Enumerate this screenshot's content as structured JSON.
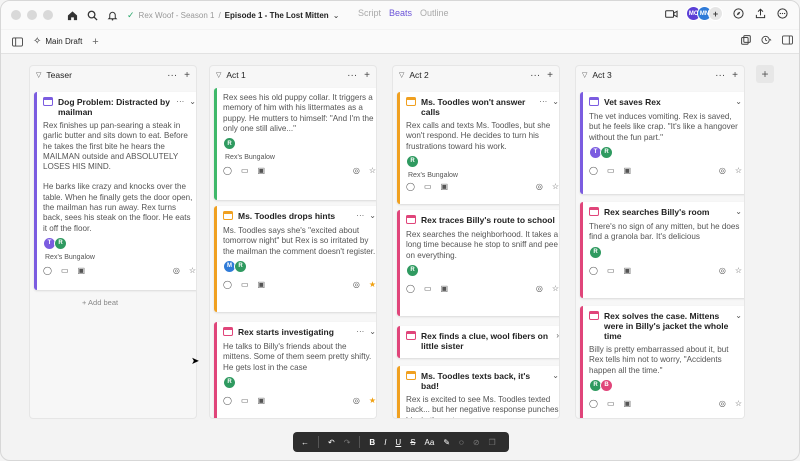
{
  "topbar": {
    "project": "Rex Woof - Season 1",
    "episode": "Episode 1 - The Lost Mitten",
    "tabs": [
      {
        "label": "Script",
        "active": false
      },
      {
        "label": "Beats",
        "active": true
      },
      {
        "label": "Outline",
        "active": false
      }
    ],
    "avatars": [
      {
        "initials": "MC",
        "color": "#5b3fd6"
      },
      {
        "initials": "MN",
        "color": "#2f7bd8"
      }
    ]
  },
  "subbar": {
    "draft_label": "Main Draft"
  },
  "columns": [
    {
      "title": "Teaser",
      "add_beat": "+ Add beat",
      "cards": [
        {
          "title": "Dog Problem: Distracted by mailman",
          "color": "#7b5ce0",
          "body": [
            "Rex finishes up pan-searing a steak in garlic butter and sits down to eat. Before he takes the first bite he hears the MAILMAN outside and ABSOLUTELY LOSES HIS MIND.",
            "He barks like crazy and knocks over the table. When he finally gets the door open, the mailman has run away. Rex turns back, sees his steak on the floor. He eats it off the floor."
          ],
          "avatars": [
            {
              "i": "T",
              "c": "#7b5ce0"
            },
            {
              "i": "R",
              "c": "#2f9a60"
            }
          ],
          "location": "Rex's Bungalow",
          "starred": false
        }
      ]
    },
    {
      "title": "Act 1",
      "cards": [
        {
          "title": "",
          "color": "#3fb86a",
          "body": [
            "Rex sees his old puppy collar. It triggers a memory of him with his littermates as a puppy. He mutters to himself: \"And I'm the only one still alive...\""
          ],
          "avatars": [
            {
              "i": "R",
              "c": "#2f9a60"
            }
          ],
          "location": "Rex's Bungalow",
          "starred": false
        },
        {
          "title": "Ms. Toodles drops hints",
          "color": "#f0a020",
          "body": [
            "Ms. Toodles says she's \"excited about tomorrow night\" but Rex is so irritated by the mailman the comment doesn't register."
          ],
          "avatars": [
            {
              "i": "M",
              "c": "#2f7bd8"
            },
            {
              "i": "R",
              "c": "#2f9a60"
            }
          ],
          "location": "",
          "starred": true
        },
        {
          "title": "Rex starts investigating",
          "color": "#e0457a",
          "body": [
            "He talks to Billy's friends about the mittens. Some of them seem pretty shifty. He gets lost in the case"
          ],
          "avatars": [
            {
              "i": "R",
              "c": "#2f9a60"
            }
          ],
          "location": "",
          "starred": true
        }
      ]
    },
    {
      "title": "Act 2",
      "cards": [
        {
          "title": "Ms. Toodles won't answer calls",
          "color": "#f0a020",
          "body": [
            "Rex calls and texts Ms. Toodles, but she won't respond. He decides to turn his frustrations toward his work."
          ],
          "avatars": [
            {
              "i": "R",
              "c": "#2f9a60"
            }
          ],
          "location": "Rex's Bungalow",
          "starred": false
        },
        {
          "title": "Rex traces Billy's route to school",
          "color": "#e0457a",
          "body": [
            "Rex searches the neighborhood. It takes a long time because he stop to sniff and pee on everything."
          ],
          "avatars": [
            {
              "i": "R",
              "c": "#2f9a60"
            }
          ],
          "location": "",
          "starred": false
        },
        {
          "title": "Rex finds a clue, wool fibers on little sister",
          "color": "#e0457a",
          "body": [],
          "avatars": [],
          "location": "",
          "starred": false
        },
        {
          "title": "Ms. Toodles texts back, it's bad!",
          "color": "#f0a020",
          "body": [
            "Rex is excited to see Ms. Toodles texted back... but her negative response punches him in the gut"
          ],
          "avatars": [],
          "location": "",
          "starred": false
        }
      ]
    },
    {
      "title": "Act 3",
      "cards": [
        {
          "title": "Vet saves Rex",
          "color": "#7b5ce0",
          "body": [
            "The vet induces vomiting. Rex is saved, but he feels like crap. \"It's like a hangover without the fun part.\""
          ],
          "avatars": [
            {
              "i": "T",
              "c": "#7b5ce0"
            },
            {
              "i": "R",
              "c": "#2f9a60"
            }
          ],
          "location": "",
          "starred": false
        },
        {
          "title": "Rex searches Billy's room",
          "color": "#e0457a",
          "body": [
            "There's no sign of any mitten, but he does find a granola bar. It's delicious"
          ],
          "avatars": [
            {
              "i": "R",
              "c": "#2f9a60"
            }
          ],
          "location": "",
          "starred": false
        },
        {
          "title": "Rex solves the case. Mittens were in Billy's jacket the whole time",
          "color": "#e0457a",
          "body": [
            "Billy is pretty embarrassed about it, but Rex tells him not to worry, \"Accidents happen all the time.\""
          ],
          "avatars": [
            {
              "i": "R",
              "c": "#2f9a60"
            },
            {
              "i": "B",
              "c": "#e0457a"
            }
          ],
          "location": "",
          "starred": false
        }
      ]
    }
  ],
  "toolbar": {
    "items": [
      "back-arrow",
      "undo",
      "redo",
      "B",
      "I",
      "U",
      "S",
      "Aa",
      "highlight",
      "comment",
      "link",
      "copy"
    ]
  }
}
